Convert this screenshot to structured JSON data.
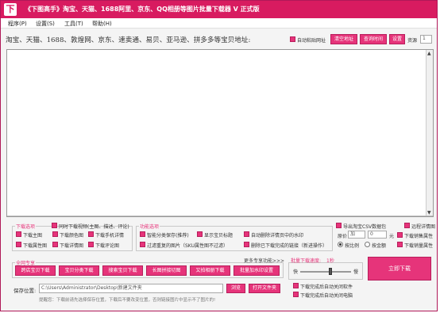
{
  "window": {
    "title": "《下图高手》淘宝、天猫、1688阿里、京东、QQ相册等图片批量下载器 V          正式版",
    "icon_name": "download-app-icon"
  },
  "menu": [
    "程序(P)",
    "设置(S)",
    "工具(T)",
    "帮助(H)"
  ],
  "top": {
    "hint_text": "淘宝、天猫、1688、敦煌网、京东、速卖通、易贝、亚马逊、拼多多等宝贝地址:",
    "auto_paste_label": "自动粘贴网址",
    "clear_label": "清空地址",
    "query_label": "查询时间",
    "settings_label": "设置",
    "resource_label": "资源",
    "stepper_value": "1"
  },
  "download_options": {
    "title": "下载选项",
    "items": [
      "下载主图",
      "下载颜色图",
      "下载属性图",
      "下载详情图",
      "下载视频",
      "下载评论图"
    ],
    "video_label": "同时下载视频(主图、描述、评论)",
    "inner_items": [
      "下载手机详情",
      "下载评论图"
    ]
  },
  "func_options": {
    "title": "功能选项",
    "items": [
      "智能分类保存(推荐)",
      "显示宝贝标题",
      "自动删除详情页中的水印",
      "过滤重复的图片（SKU属性图不过滤）",
      "删除已下载完成的链接（新进操作）"
    ]
  },
  "right_options": {
    "csv_label": "导出淘宝CSV数据包",
    "convert_label": "远程详情图",
    "price_label": "原价",
    "price_mode": "加",
    "price_value": "0",
    "unit_label": "元",
    "keep_label": "下载销售属性",
    "new_label": "下载新品属性",
    "radio_a": "按比例",
    "radio_b": "按金额",
    "download_props_label": "下载销量属性"
  },
  "special": {
    "title": "全网专享",
    "more_label": "更多专享功能>>>",
    "buttons": [
      "跨店宝贝下载",
      "宝贝分类下载",
      "搜索宝贝下载",
      "长图拼接切图",
      "又拍相册下载",
      "批量加水印设置"
    ]
  },
  "speed": {
    "label": "批量下载速度:",
    "value": "1秒",
    "fast": "快",
    "slow": "慢",
    "level": 0.6,
    "auto_close_label": "下载完成后自动关闭软件",
    "shutdown_label": "下载完成后自动关闭电脑"
  },
  "save": {
    "label": "保存位置:",
    "path": "C:\\Users\\Administrator\\Desktop\\新建文件夹",
    "browse_label": "浏览",
    "open_label": "打开文件夹",
    "tip": "提醒您：下载前请先选择保存位置，下载后不要改变位置，否则链接图片中显示不了图片的!"
  },
  "start_label": "立即下载",
  "colors": {
    "accent": "#e6347a",
    "titlebar": "#d81b60"
  }
}
